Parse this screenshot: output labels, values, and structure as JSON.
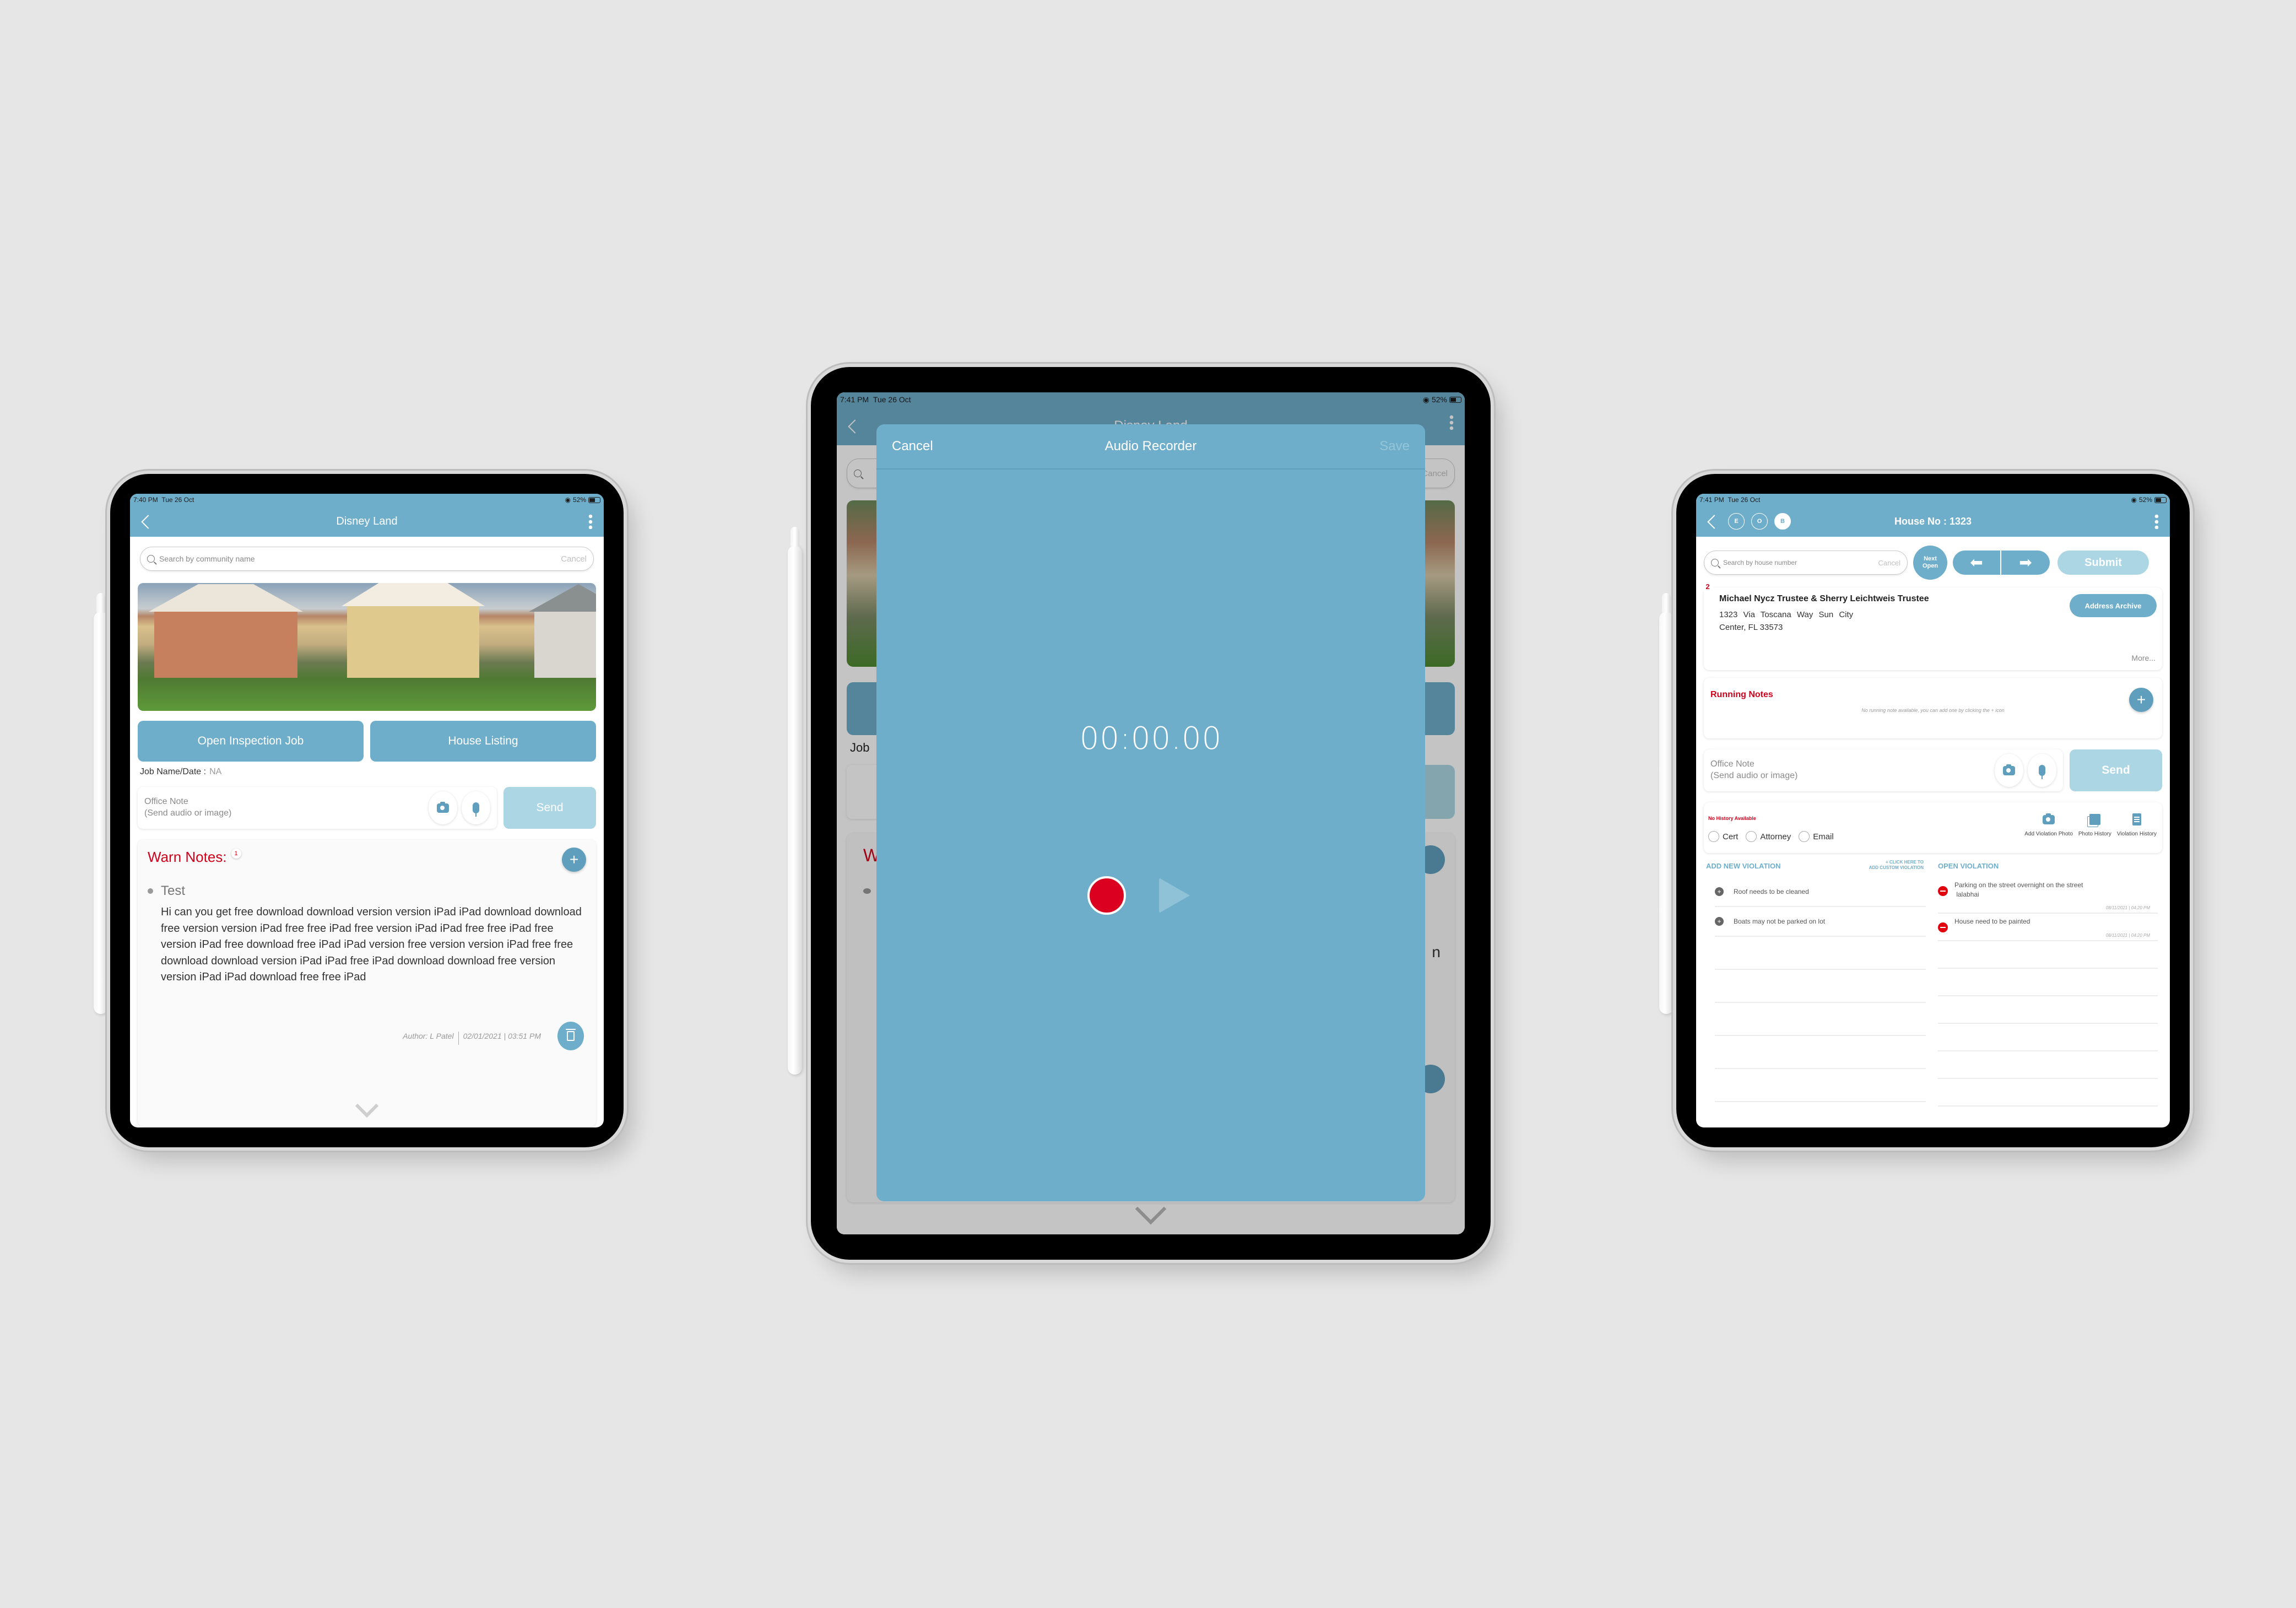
{
  "status_bar": {
    "left_time": "7:40 PM",
    "mid_time": "7:41 PM",
    "right_time": "7:41 PM",
    "date": "Tue 26 Oct",
    "battery": "52%"
  },
  "colors": {
    "primary": "#6eaeca",
    "primary_light": "#acd6e3",
    "warning_red": "#d0021b",
    "record_red": "#dc0020",
    "background": "#e6e6e6"
  },
  "left_screen": {
    "title": "Disney Land",
    "search_placeholder": "Search by community name",
    "search_cancel": "Cancel",
    "photo_alt": "Row of craftsman cottages with garden",
    "buttons": {
      "open_job": "Open Inspection Job",
      "house_listing": "House Listing"
    },
    "job_label": "Job Name/Date :",
    "job_value": "NA",
    "office_note_placeholder": "Office Note\n(Send audio or image)",
    "office_note_line1": "Office Note",
    "office_note_line2": "(Send audio or image)",
    "send_label": "Send",
    "warn_notes": {
      "title": "Warn Notes:",
      "count": "1",
      "item_title": "Test",
      "item_body": "Hi can you get free download download version version iPad iPad download download free version version iPad free free iPad free version iPad iPad free free iPad free version iPad free download free iPad iPad version free version version iPad free free download download version iPad iPad free iPad download download free version version iPad iPad download free free iPad",
      "author": "Author: L Patel",
      "timestamp": "02/01/2021 | 03:51 PM"
    }
  },
  "middle_screen": {
    "background_title": "Disney Land",
    "background_job_label": "Job",
    "background_warn_letter": "W",
    "background_trailing": "n",
    "modal": {
      "cancel_label": "Cancel",
      "title": "Audio Recorder",
      "save_label": "Save",
      "timer": "00:00.00"
    }
  },
  "right_screen": {
    "title": "House No : 1323",
    "tags": [
      "E",
      "O",
      "B"
    ],
    "active_tag": "B",
    "search_placeholder": "Search by house number",
    "search_cancel": "Cancel",
    "next_open_line1": "Next",
    "next_open_line2": "Open",
    "submit_label": "Submit",
    "owner": {
      "index": "2",
      "name": "Michael Nycz Trustee & Sherry Leichtweis Trustee",
      "address_line1": "1323 Via Toscana Way Sun City",
      "address_line2": "Center, FL 33573",
      "archive_label": "Address Archive",
      "more_label": "More..."
    },
    "running_notes": {
      "title": "Running Notes",
      "empty_text": "No running note available, you can add one by clicking the + icon"
    },
    "office_note_line1": "Office Note",
    "office_note_line2": "(Send audio or image)",
    "send_label": "Send",
    "history": {
      "no_history": "No History Available",
      "radios": [
        "Cert",
        "Attorney",
        "Email"
      ],
      "tools": [
        "Add Violation Photo",
        "Photo History",
        "Violation History"
      ]
    },
    "add_violation": {
      "title": "ADD NEW VIOLATION",
      "custom_line1": "+ CLICK HERE TO",
      "custom_line2": "ADD CUSTOM VIOLATION",
      "items": [
        "Roof needs to be cleaned",
        "Boats may not be parked on lot"
      ]
    },
    "open_violation": {
      "title": "OPEN VIOLATION",
      "items": [
        {
          "text": "Parking on the street overnight on the street",
          "subtext": "lalabhai",
          "timestamp": "08/11/2021 | 04:20 PM"
        },
        {
          "text": "House need to be painted",
          "subtext": "",
          "timestamp": "08/11/2021 | 04:20 PM"
        }
      ]
    }
  }
}
